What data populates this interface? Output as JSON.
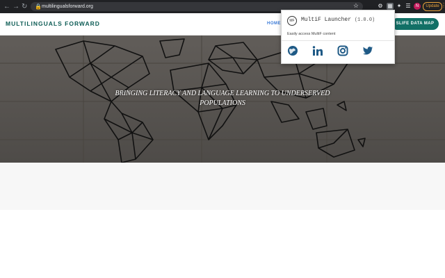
{
  "browser": {
    "url": "multilingualsforward.org",
    "update_label": "Update",
    "avatar_letter": "N"
  },
  "site": {
    "logo": "MULTILINGUALS FORWARD",
    "nav_home": "HOME",
    "cta": "SLIFE DATA MAP",
    "hero_title": "BRINGING LITERACY AND LANGUAGE LEARNING TO UNDERSERVED POPULATIONS"
  },
  "popup": {
    "logo_text": "MF",
    "title": "MultiF Launcher",
    "version": "(1.0.0)",
    "description": "Easily access MultiF content",
    "icons": [
      "globe-icon",
      "linkedin-icon",
      "instagram-icon",
      "twitter-icon"
    ]
  },
  "colors": {
    "brand": "#0d5c55",
    "cta": "#127066",
    "nav_link": "#3b7bd8",
    "icon": "#1f5a86"
  }
}
